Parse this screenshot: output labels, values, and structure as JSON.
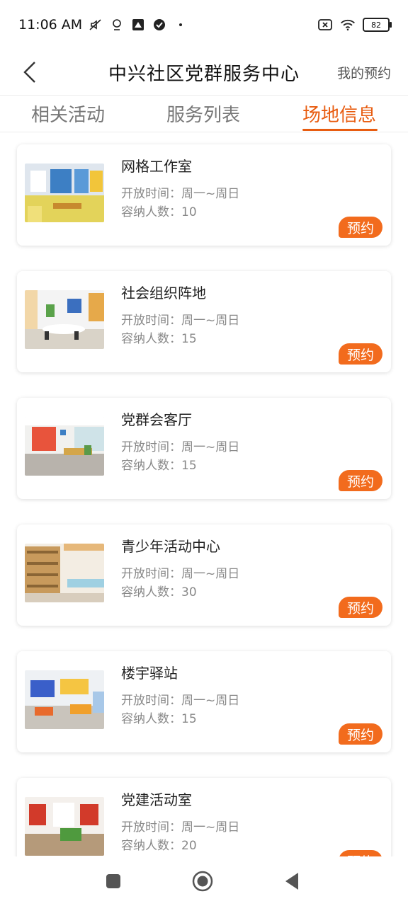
{
  "status_bar": {
    "time": "11:06 AM",
    "battery": "82"
  },
  "header": {
    "title": "中兴社区党群服务中心",
    "right_action": "我的预约"
  },
  "tabs": [
    {
      "label": "相关活动",
      "active": false
    },
    {
      "label": "服务列表",
      "active": false
    },
    {
      "label": "场地信息",
      "active": true
    }
  ],
  "venues": [
    {
      "name": "网格工作室",
      "hours": "开放时间：周一~周日",
      "capacity": "容纳人数：10",
      "book": "预约"
    },
    {
      "name": "社会组织阵地",
      "hours": "开放时间：周一~周日",
      "capacity": "容纳人数：15",
      "book": "预约"
    },
    {
      "name": "党群会客厅",
      "hours": "开放时间：周一~周日",
      "capacity": "容纳人数：15",
      "book": "预约"
    },
    {
      "name": "青少年活动中心",
      "hours": "开放时间：周一~周日",
      "capacity": "容纳人数：30",
      "book": "预约"
    },
    {
      "name": "楼宇驿站",
      "hours": "开放时间：周一~周日",
      "capacity": "容纳人数：15",
      "book": "预约"
    },
    {
      "name": "党建活动室",
      "hours": "开放时间：周一~周日",
      "capacity": "容纳人数：20",
      "book": "预约"
    }
  ],
  "colors": {
    "accent": "#e85c10",
    "button": "#f26b1d"
  },
  "icons": {
    "back": "back-arrow-icon",
    "nav_recent": "square-icon",
    "nav_home": "circle-icon",
    "nav_back": "triangle-icon"
  }
}
